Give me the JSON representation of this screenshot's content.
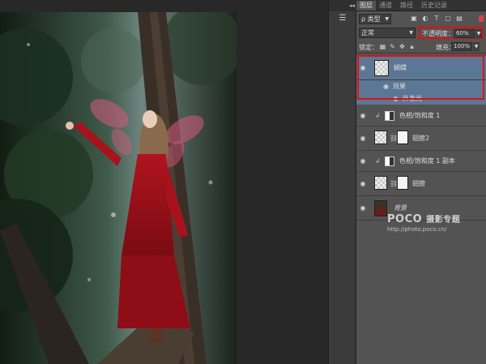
{
  "tabs": [
    {
      "label": "图层"
    },
    {
      "label": "通道"
    },
    {
      "label": "路径"
    },
    {
      "label": "历史记录"
    }
  ],
  "filter": {
    "kind_label": "ρ 类型",
    "icons": [
      "image-icon",
      "adjustment-icon",
      "type-icon",
      "shape-icon",
      "smart-object-icon"
    ]
  },
  "blend_mode": "正常",
  "opacity": {
    "label": "不透明度：",
    "value": "60%"
  },
  "lock": {
    "label": "锁定："
  },
  "fill": {
    "label": "填充：",
    "value": "100%"
  },
  "layers": [
    {
      "name": "蝴蝶",
      "selected": true,
      "effects_label": "效果",
      "effect": "外发光"
    },
    {
      "name": "色相/饱和度 1",
      "type": "adjustment"
    },
    {
      "name": "翅膀2",
      "type": "masked"
    },
    {
      "name": "色相/饱和度 1 副本",
      "type": "adjustment"
    },
    {
      "name": "翅膀",
      "type": "masked"
    },
    {
      "name": "背景",
      "type": "background"
    }
  ],
  "watermark": {
    "brand": "POCO",
    "suffix": "摄影专题",
    "url": "http://photo.poco.cn/"
  },
  "colors": {
    "highlight": "#e01010",
    "selected_row": "#5c7795",
    "panel": "#535353"
  }
}
